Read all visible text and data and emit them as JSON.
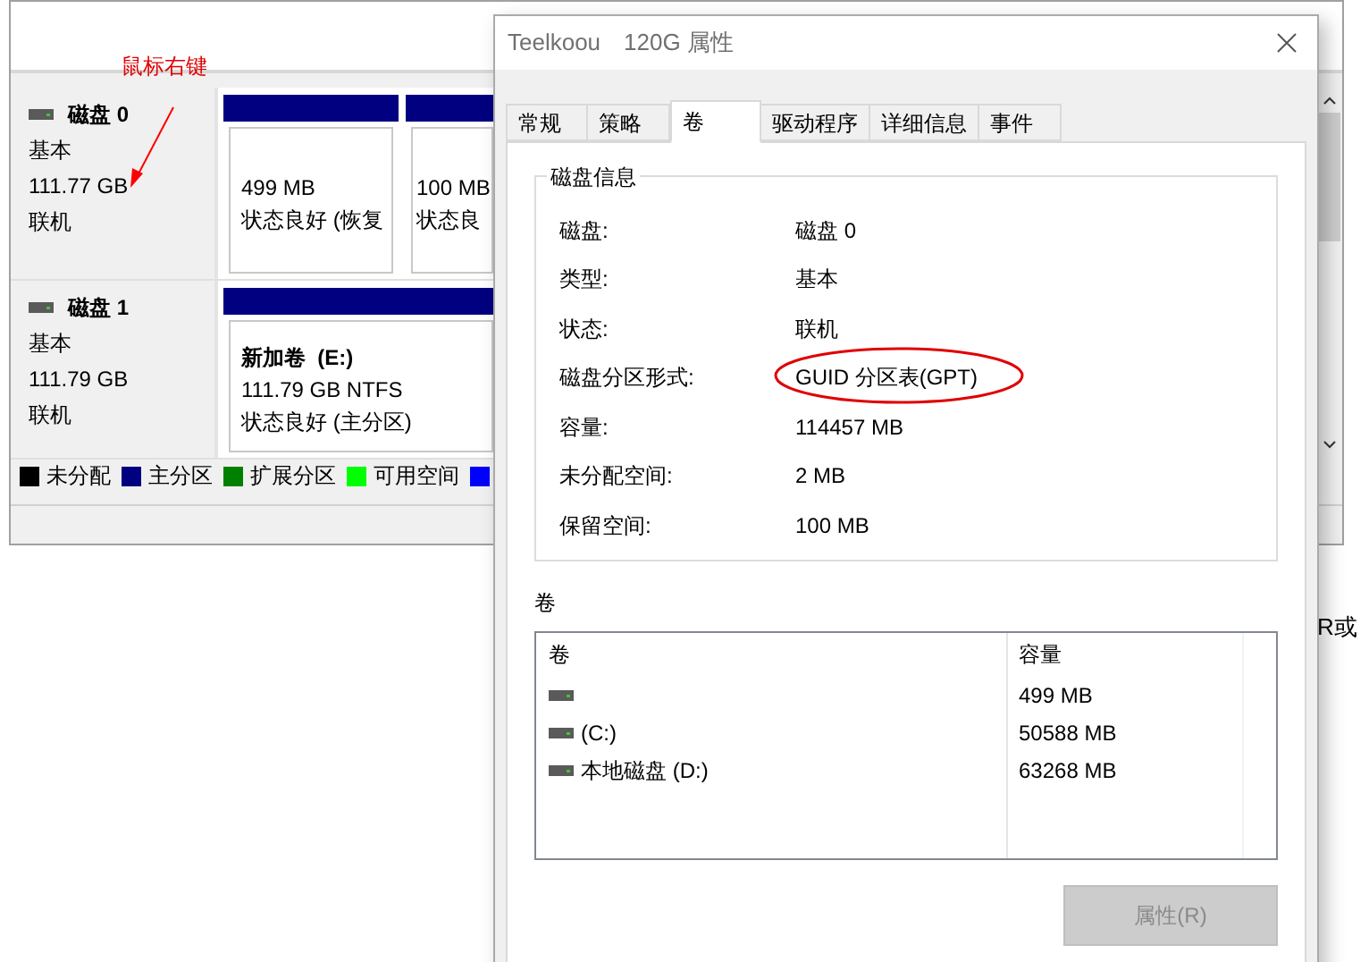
{
  "annotation": {
    "text": "鼠标右键"
  },
  "disk_management": {
    "disks": [
      {
        "name": "磁盘 0",
        "type": "基本",
        "size": "111.77 GB",
        "status": "联机",
        "partitions": [
          {
            "size": "499 MB",
            "status": "状态良好 (恢复"
          },
          {
            "size": "100 MB",
            "status": "状态良"
          }
        ]
      },
      {
        "name": "磁盘 1",
        "type": "基本",
        "size": "111.79 GB",
        "status": "联机",
        "partitions": [
          {
            "label": "新加卷  (E:)",
            "size": "111.79 GB NTFS",
            "status": "状态良好 (主分区)"
          }
        ]
      }
    ],
    "legend": [
      {
        "label": "未分配",
        "color": "#000000"
      },
      {
        "label": "主分区",
        "color": "#000080"
      },
      {
        "label": "扩展分区",
        "color": "#008000"
      },
      {
        "label": "可用空间",
        "color": "#00ff00"
      },
      {
        "color": "#0000ff"
      }
    ],
    "background_text": "R或"
  },
  "dialog": {
    "title": "Teelkoou　120G 属性",
    "tabs": [
      {
        "label": "常规",
        "selected": false
      },
      {
        "label": "策略",
        "selected": false
      },
      {
        "label": "卷",
        "selected": true
      },
      {
        "label": "驱动程序",
        "selected": false
      },
      {
        "label": "详细信息",
        "selected": false
      },
      {
        "label": "事件",
        "selected": false
      }
    ],
    "disk_info": {
      "title": "磁盘信息",
      "rows": [
        {
          "label": "磁盘:",
          "value": "磁盘 0",
          "circled": false
        },
        {
          "label": "类型:",
          "value": "基本",
          "circled": false
        },
        {
          "label": "状态:",
          "value": "联机",
          "circled": false
        },
        {
          "label": "磁盘分区形式:",
          "value": "GUID 分区表(GPT)",
          "circled": true
        },
        {
          "label": "容量:",
          "value": "114457 MB",
          "circled": false
        },
        {
          "label": "未分配空间:",
          "value": "2 MB",
          "circled": false
        },
        {
          "label": "保留空间:",
          "value": "100 MB",
          "circled": false
        }
      ]
    },
    "volumes": {
      "title": "卷",
      "columns": [
        "卷",
        "容量"
      ],
      "rows": [
        {
          "capacity": "499 MB"
        },
        {
          "name": "(C:)",
          "capacity": "50588 MB"
        },
        {
          "name": "本地磁盘 (D:)",
          "capacity": "63268 MB"
        }
      ]
    },
    "button": {
      "label": "属性(R)",
      "disabled": true
    }
  }
}
